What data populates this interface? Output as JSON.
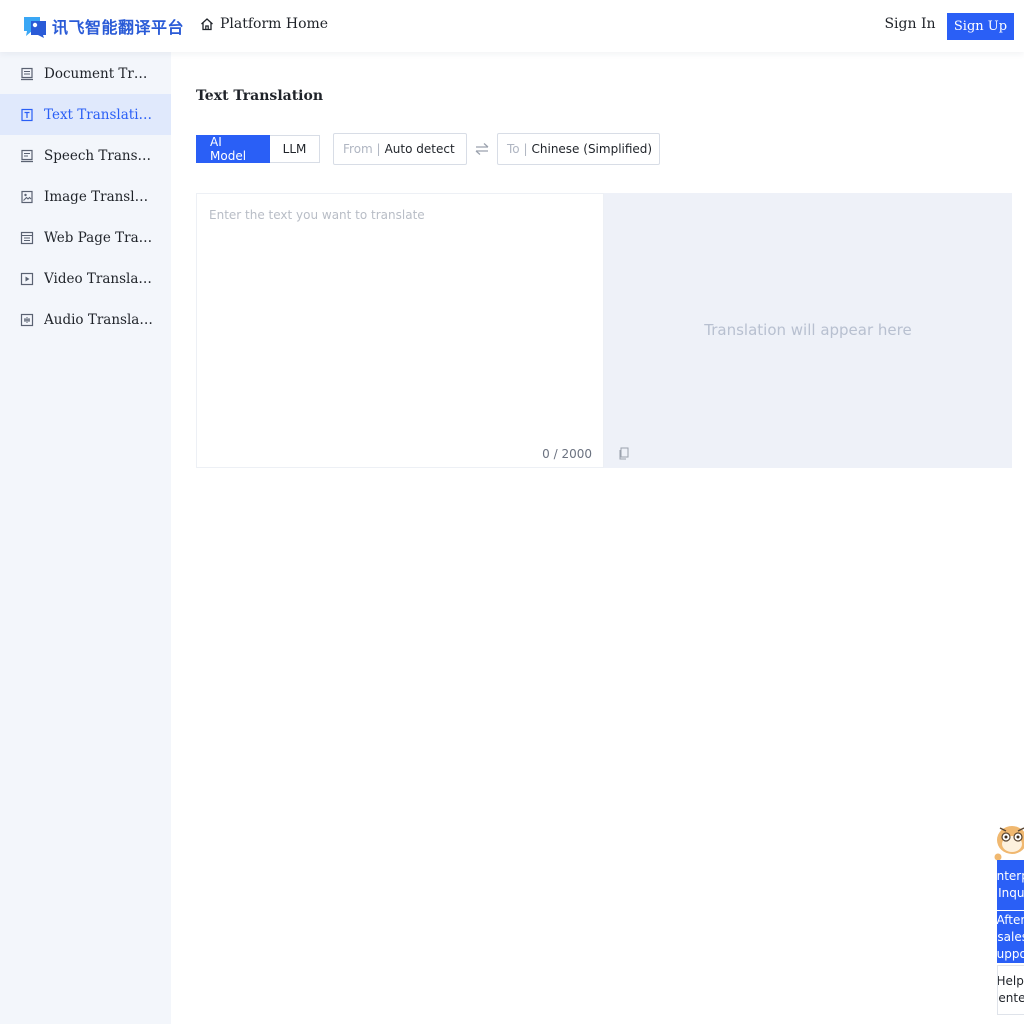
{
  "header": {
    "logo_text": "讯飞智能翻译平台",
    "home_label": "Platform Home",
    "signin_label": "Sign In",
    "signup_label": "Sign Up"
  },
  "sidebar": {
    "items": [
      {
        "label": "Document Translation",
        "icon": "document-icon",
        "active": false
      },
      {
        "label": "Text Translation",
        "icon": "text-icon",
        "active": true
      },
      {
        "label": "Speech Translation",
        "icon": "speech-icon",
        "active": false
      },
      {
        "label": "Image Translation",
        "icon": "image-icon",
        "active": false
      },
      {
        "label": "Web Page Translation",
        "icon": "webpage-icon",
        "active": false
      },
      {
        "label": "Video Translation",
        "icon": "video-icon",
        "active": false
      },
      {
        "label": "Audio Translation",
        "icon": "audio-icon",
        "active": false
      }
    ]
  },
  "main": {
    "title": "Text Translation",
    "mode_ai": "AI Model",
    "mode_llm": "LLM",
    "from_prefix": "From |",
    "from_value": "Auto detect",
    "to_prefix": "To |",
    "to_value": "Chinese (Simplified)",
    "source_placeholder": "Enter the text you want to translate",
    "source_value": "",
    "counter": "0 / 2000",
    "target_placeholder": "Translation will appear here"
  },
  "float_widget": {
    "enterprise_inquiry": "Enterprise Inquiry",
    "after_sales": "After-sales Support",
    "help_center": "Help Center"
  },
  "colors": {
    "accent": "#2a5ff6",
    "sidebar_bg": "#f3f6fb",
    "sidebar_active_bg": "#e0e9fc",
    "target_bg": "#eef1f8"
  }
}
